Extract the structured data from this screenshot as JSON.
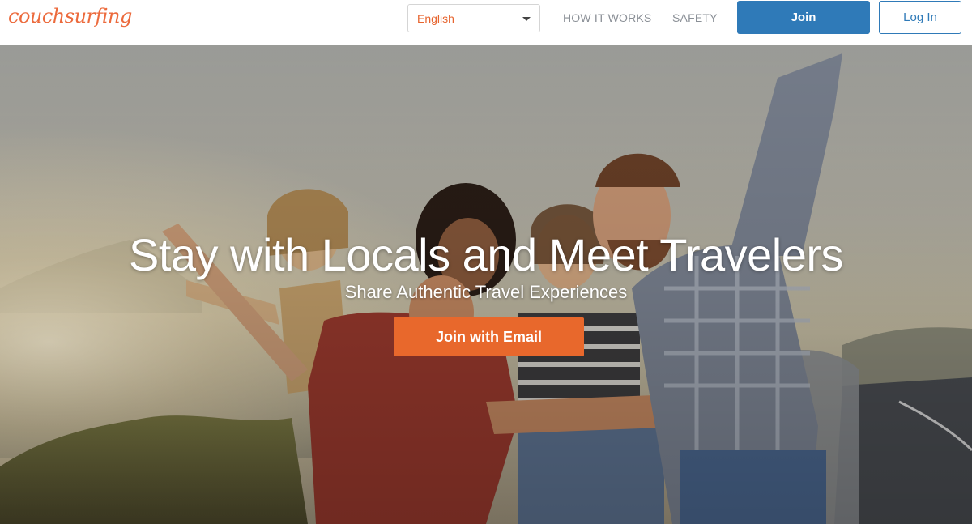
{
  "header": {
    "logo_text": "couchsurfing",
    "language": {
      "selected": "English"
    },
    "nav": {
      "how_it_works": "HOW IT WORKS",
      "safety": "SAFETY"
    },
    "join_label": "Join",
    "login_label": "Log In"
  },
  "hero": {
    "headline": "Stay with Locals and Meet Travelers",
    "subheadline": "Share Authentic Travel Experiences",
    "cta_label": "Join with Email"
  },
  "colors": {
    "brand_orange": "#e8682c",
    "primary_blue": "#2f7ab8",
    "nav_gray": "#8a8f96"
  },
  "icons": {
    "language_dropdown": "chevron-down-icon"
  }
}
